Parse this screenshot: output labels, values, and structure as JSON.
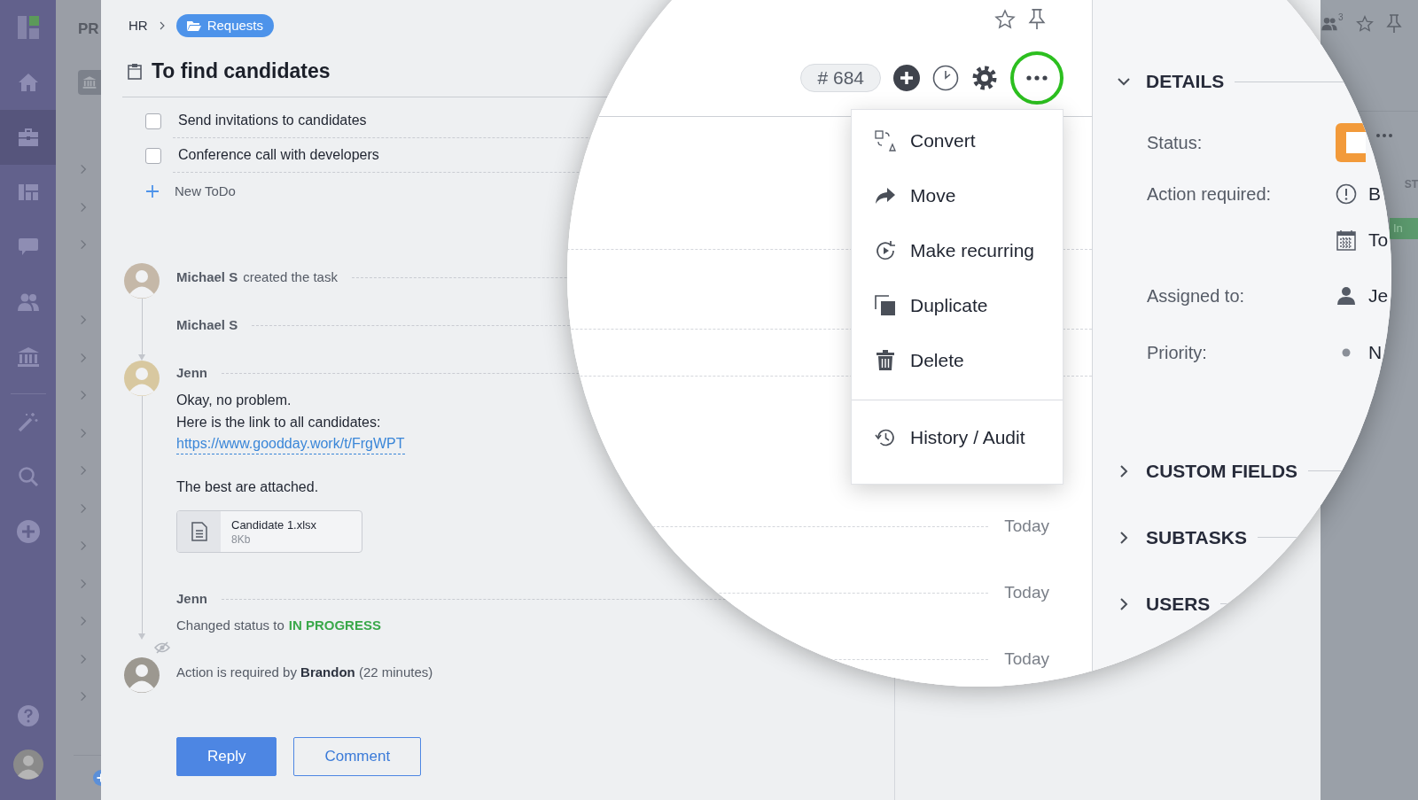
{
  "nav": {
    "items": [
      {
        "kind": "home",
        "selected": false
      },
      {
        "kind": "briefcase",
        "selected": true
      },
      {
        "kind": "dashboard",
        "selected": false
      },
      {
        "kind": "chat",
        "selected": false
      },
      {
        "kind": "people",
        "selected": false
      },
      {
        "kind": "bank",
        "selected": false
      }
    ],
    "tools": [
      {
        "kind": "wand"
      },
      {
        "kind": "search"
      },
      {
        "kind": "add"
      }
    ]
  },
  "project_panel": {
    "title": "PR"
  },
  "breadcrumb": [
    {
      "kind": "text",
      "label": "HR"
    },
    {
      "kind": "folder",
      "label": "Requests"
    }
  ],
  "task": {
    "title": "To find candidates"
  },
  "todos": [
    {
      "label": "Send invitations to candidates",
      "checked": false
    },
    {
      "label": "Conference call with developers",
      "checked": false
    }
  ],
  "new_todo": {
    "label": "New ToDo"
  },
  "timeline": [
    {
      "kind": "created",
      "avatar": true,
      "author": "Michael S",
      "text": "created the task"
    },
    {
      "kind": "message",
      "avatar": false,
      "author": "Michael S"
    },
    {
      "kind": "message",
      "avatar": true,
      "author": "Jenn",
      "lines": [
        "Okay, no problem.",
        "Here is the link to all candidates:"
      ],
      "link": "https://www.goodday.work/t/FrgWPT",
      "note": "The best are attached.",
      "attachment": {
        "name": "Candidate 1.xlsx",
        "size": "8Kb"
      }
    },
    {
      "kind": "status",
      "avatar": false,
      "author": "Jenn",
      "text": "Changed status to",
      "status": "IN PROGRESS"
    },
    {
      "kind": "action",
      "avatar": true,
      "text": "Action is required by **Brandon** (22 minutes)"
    }
  ],
  "buttons": [
    {
      "kind": "primary",
      "label": "Reply"
    },
    {
      "kind": "secondary",
      "label": "Comment"
    }
  ],
  "top_right": {
    "watchers": "3",
    "column_label": "ST",
    "badge": "In"
  },
  "magnifier": {
    "task_number": "# 684",
    "menu": {
      "items": [
        {
          "kind": "convert",
          "label": "Convert"
        },
        {
          "kind": "move",
          "label": "Move"
        },
        {
          "kind": "recurring",
          "label": "Make recurring"
        },
        {
          "kind": "duplicate",
          "label": "Duplicate"
        },
        {
          "kind": "delete",
          "label": "Delete"
        }
      ],
      "footer_items": [
        {
          "kind": "history",
          "label": "History / Audit"
        }
      ]
    },
    "activity_dates": [
      "Today",
      "Today",
      "Today"
    ],
    "details": {
      "title": "DETAILS",
      "expanded": true,
      "fields": [
        {
          "kind": "status",
          "label": "Status:"
        },
        {
          "kind": "values",
          "label": "Action required:",
          "values": [
            {
              "kind": "alert",
              "text": "B"
            },
            {
              "kind": "calendar",
              "text": "To"
            }
          ]
        },
        {
          "kind": "values",
          "label": "Assigned to:",
          "values": [
            {
              "kind": "person",
              "text": "Je"
            }
          ]
        },
        {
          "kind": "values",
          "label": "Priority:",
          "values": [
            {
              "kind": "dot",
              "text": "N"
            }
          ]
        }
      ]
    },
    "sections": [
      {
        "title": "CUSTOM FIELDS",
        "expanded": false
      },
      {
        "title": "SUBTASKS",
        "expanded": false
      },
      {
        "title": "USERS",
        "expanded": false
      }
    ]
  }
}
